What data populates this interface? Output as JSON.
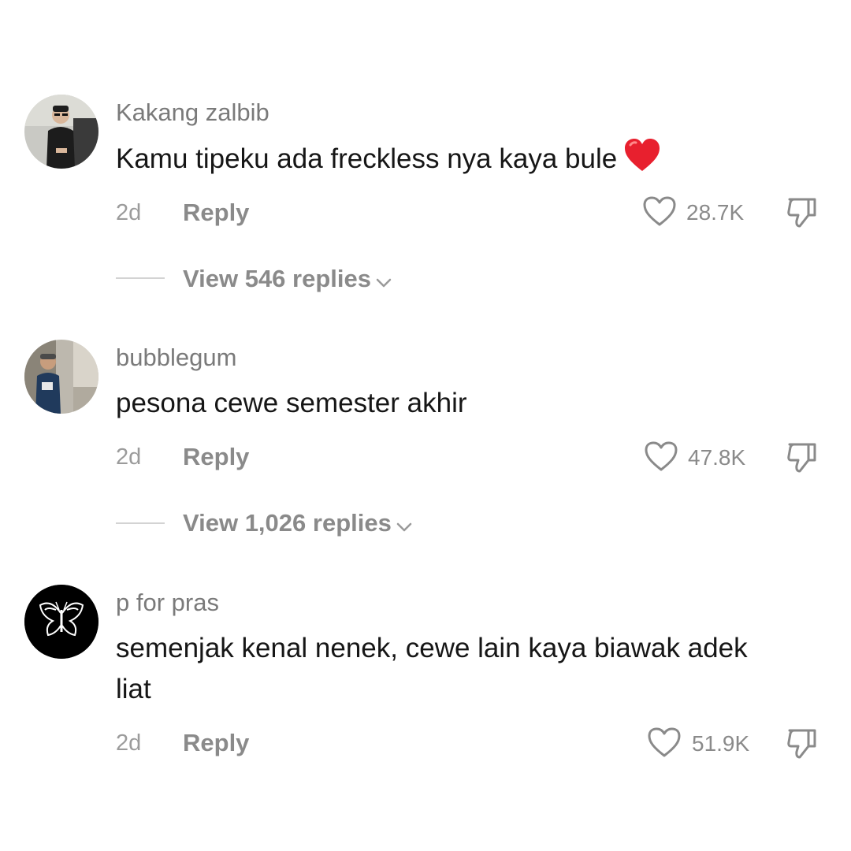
{
  "comments": [
    {
      "username": "Kakang zalbib",
      "text": "Kamu tipeku ada freckless nya kaya bule",
      "emoji": "red-heart",
      "time": "2d",
      "reply_label": "Reply",
      "likes": "28.7K",
      "view_replies": "View 546 replies"
    },
    {
      "username": "bubblegum",
      "text": "pesona cewe semester akhir",
      "time": "2d",
      "reply_label": "Reply",
      "likes": "47.8K",
      "view_replies": "View 1,026 replies"
    },
    {
      "username": "p for pras",
      "text": "semenjak kenal nenek, cewe lain kaya biawak adek liat",
      "time": "2d",
      "reply_label": "Reply",
      "likes": "51.9K"
    }
  ],
  "icons": {
    "like": "heart-outline-icon",
    "dislike": "thumbs-down-icon",
    "expand": "chevron-down-icon"
  },
  "colors": {
    "username": "#7a7a7a",
    "text": "#161616",
    "meta": "#8a8a8a",
    "emoji_heart": "#e8202e"
  }
}
